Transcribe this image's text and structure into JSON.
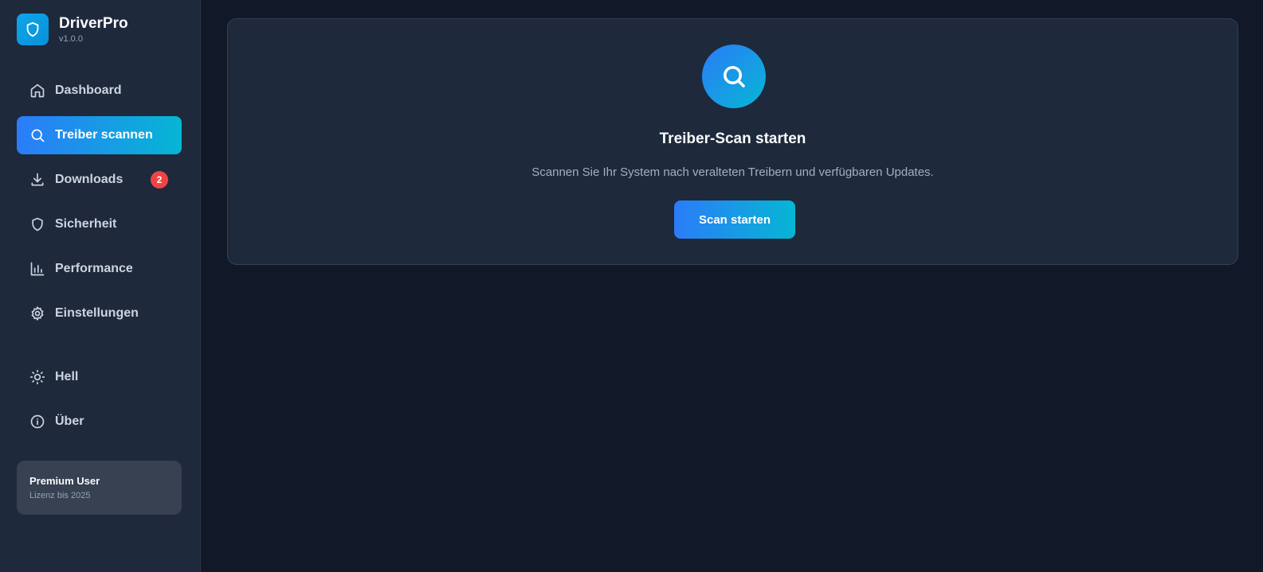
{
  "brand": {
    "name": "DriverPro",
    "version": "v1.0.0",
    "icon": "shield-icon"
  },
  "nav": {
    "dashboard": {
      "label": "Dashboard",
      "icon": "home-icon"
    },
    "scan": {
      "label": "Treiber scannen",
      "icon": "search-icon",
      "active": true
    },
    "downloads": {
      "label": "Downloads",
      "icon": "download-icon",
      "badge": "2"
    },
    "security": {
      "label": "Sicherheit",
      "icon": "shield-icon"
    },
    "performance": {
      "label": "Performance",
      "icon": "bar-chart-icon"
    },
    "settings": {
      "label": "Einstellungen",
      "icon": "gear-icon"
    },
    "theme": {
      "label": "Hell",
      "icon": "sun-icon"
    },
    "about": {
      "label": "Über",
      "icon": "info-icon"
    }
  },
  "user": {
    "name": "Premium User",
    "license": "Lizenz bis 2025"
  },
  "scan_card": {
    "title": "Treiber-Scan starten",
    "description": "Scannen Sie Ihr System nach veralteten Treibern und verfügbaren Updates.",
    "button_label": "Scan starten",
    "icon": "search-icon"
  },
  "colors": {
    "background": "#111827",
    "sidebar": "#1e293b",
    "accent_start": "#2b7cf8",
    "accent_end": "#06b6d4",
    "badge": "#ef4444"
  }
}
